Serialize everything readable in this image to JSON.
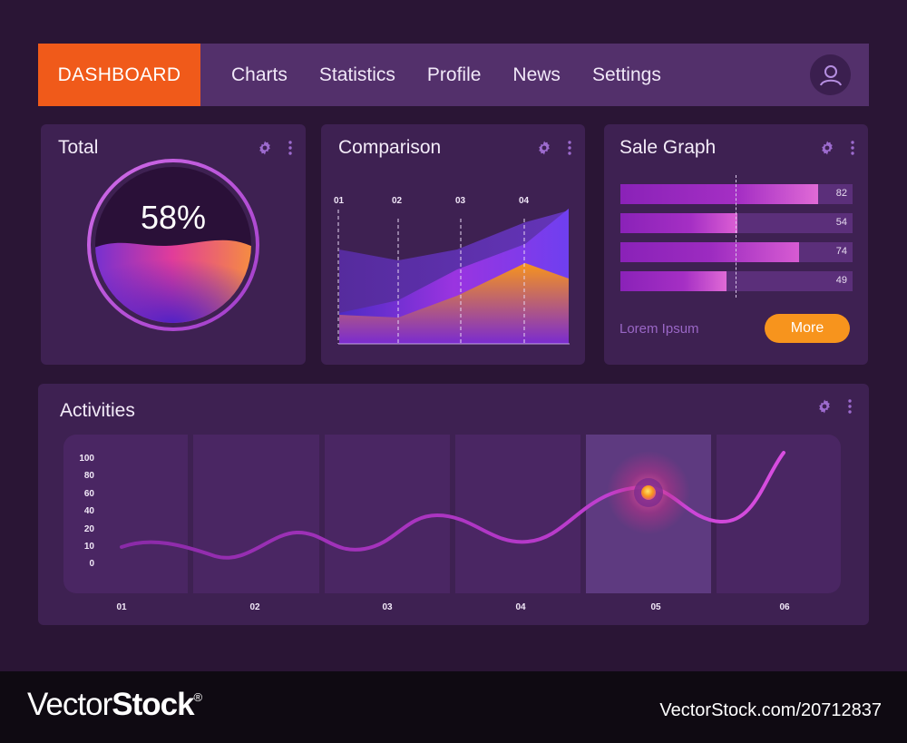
{
  "nav": {
    "brand": "DASHBOARD",
    "links": [
      "Charts",
      "Statistics",
      "Profile",
      "News",
      "Settings"
    ]
  },
  "total": {
    "title": "Total",
    "percent_label": "58%",
    "percent_value": 58
  },
  "comparison": {
    "title": "Comparison",
    "chart_data": {
      "type": "area",
      "title": "Comparison",
      "x": [
        "01",
        "02",
        "03",
        "04"
      ],
      "grid": "vertical-dashed"
    }
  },
  "sale": {
    "title": "Sale Graph",
    "footer_text": "Lorem Ipsum",
    "more_label": "More",
    "chart_data": {
      "type": "bar",
      "orientation": "horizontal",
      "title": "Sale Graph",
      "values": [
        82,
        54,
        74,
        49
      ],
      "labels": [
        "82",
        "54",
        "74",
        "49"
      ]
    }
  },
  "activities": {
    "title": "Activities",
    "chart_data": {
      "type": "line",
      "title": "Activities",
      "x": [
        "01",
        "02",
        "03",
        "04",
        "05",
        "06"
      ],
      "y_ticks": [
        "100",
        "80",
        "60",
        "40",
        "20",
        "10",
        "0"
      ],
      "highlighted_category": "05"
    }
  },
  "footer": {
    "logo_light": "Vector",
    "logo_bold": "Stock",
    "logo_mark": "®",
    "image_id": "VectorStock.com/20712837"
  },
  "colors": {
    "accent": "#f05a1a",
    "button": "#f7941d",
    "panel": "#3e2152",
    "nav": "#53306b",
    "background": "#2a1535"
  }
}
